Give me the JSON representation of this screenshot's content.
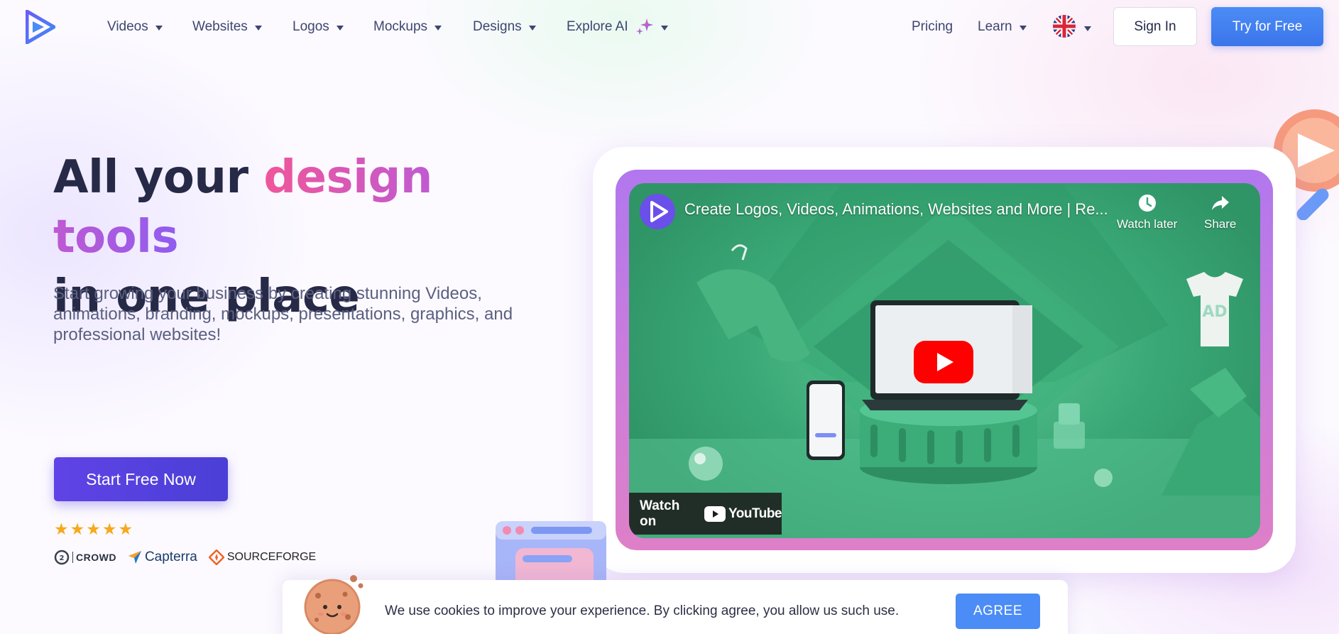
{
  "nav": {
    "items": [
      {
        "label": "Videos"
      },
      {
        "label": "Websites"
      },
      {
        "label": "Logos"
      },
      {
        "label": "Mockups"
      },
      {
        "label": "Designs"
      },
      {
        "label": "Explore AI"
      }
    ],
    "pricing_label": "Pricing",
    "learn_label": "Learn",
    "sign_in_label": "Sign In",
    "try_free_label": "Try for Free"
  },
  "hero": {
    "headline_part1": "All your ",
    "headline_highlight": "design tools",
    "headline_part2": "in one place",
    "subtext": "Start growing your business by creating stunning Videos, animations, branding, mockups, presentations, graphics, and professional websites!",
    "cta_label": "Start Free Now",
    "rating_stars": 5,
    "review_badges": [
      "CROWD",
      "Capterra",
      "SOURCEFORGE"
    ]
  },
  "video": {
    "title": "Create Logos, Videos, Animations, Websites and More | Re...",
    "watch_later_label": "Watch later",
    "share_label": "Share",
    "watch_on_label": "Watch on",
    "youtube_label": "YouTube",
    "tshirt_text": "AD"
  },
  "cookie": {
    "message": "We use cookies to improve your experience. By clicking agree, you allow us such use.",
    "agree_label": "AGREE"
  },
  "colors": {
    "primary_blue": "#4b8cf6",
    "cta_purple": "#5a42e2",
    "headline_dark": "#262a47",
    "gradient_pink": "#f0569a",
    "gradient_purple": "#8f5cf0",
    "star_yellow": "#f7a81c"
  }
}
